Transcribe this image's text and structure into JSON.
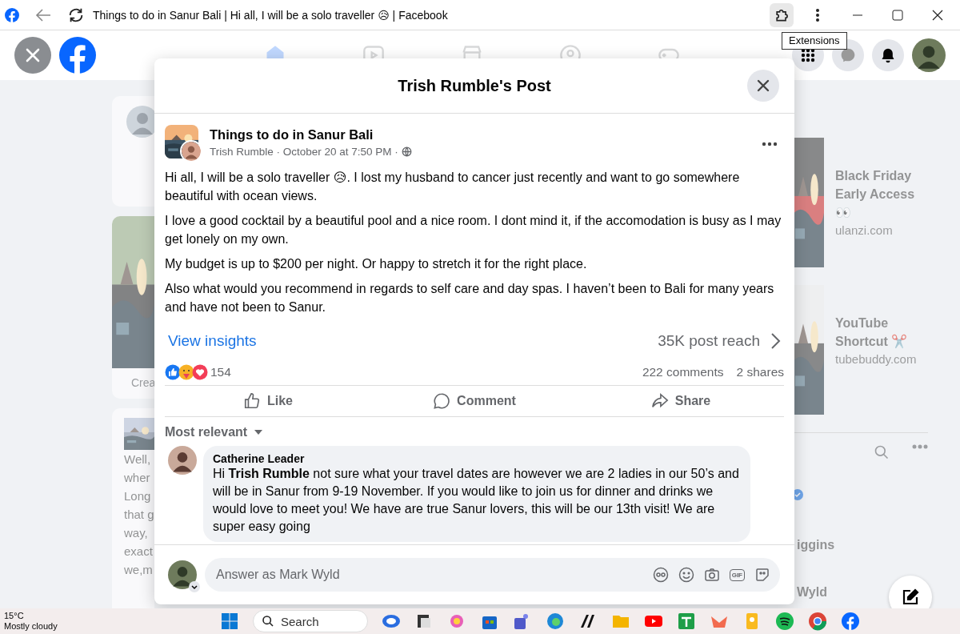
{
  "browser": {
    "title": "Things to do in Sanur Bali | Hi all, I will be a solo traveller 😥 | Facebook",
    "tooltip": "Extensions"
  },
  "background": {
    "story_label": "Crea",
    "post_text": [
      "Well,",
      "wher",
      "Long",
      "that g",
      "way,",
      "exact",
      "we,m"
    ],
    "ads": [
      {
        "title": "Black Friday Early Access 👀",
        "domain": "ulanzi.com"
      },
      {
        "title": "YouTube Shortcut ✂️",
        "domain": "tubebuddy.com"
      }
    ],
    "contacts": [
      "iggins",
      "Wyld"
    ]
  },
  "post_dialog": {
    "title": "Trish Rumble's Post",
    "group": "Things to do in Sanur Bali",
    "meta": "Trish Rumble · October 20 at 7:50 PM ·",
    "paragraphs": [
      "Hi all, I will be a solo traveller 😥. I lost my husband to cancer just recently and want to go somewhere beautiful with ocean views.",
      "I love a good cocktail by a beautiful pool and a nice room. I dont mind it, if the accomodation is busy as I may get lonely on my own.",
      "My budget is up to $200 per night. Or happy to stretch it for the right place.",
      "Also what would you recommend in regards to self care and day spas. I haven’t been to Bali for many years and have not been to Sanur."
    ],
    "insights": "View insights",
    "reach": "35K post reach",
    "reaction_count": "154",
    "comments_count": "222 comments",
    "shares": "2 shares",
    "actions": [
      {
        "label": "Like",
        "kind": "like"
      },
      {
        "label": "Comment",
        "kind": "comment"
      },
      {
        "label": "Share",
        "kind": "share"
      }
    ],
    "sort": "Most relevant",
    "comments": [
      {
        "author": "Catherine Leader",
        "text": "Hi **Trish Rumble** not sure what your travel dates are however we are 2 ladies in our 50’s and will be in Sanur from 9-19 November. If you would like to join us for dinner and drinks we would love to meet you! We have are true Sanur lovers, this will be our 13th visit! We are super easy going"
      }
    ],
    "composer": {
      "placeholder": "Answer as Mark Wyld",
      "gif": "GIF"
    }
  },
  "taskbar": {
    "temperature": "15°C",
    "weather": "Mostly cloudy",
    "search": "Search"
  }
}
